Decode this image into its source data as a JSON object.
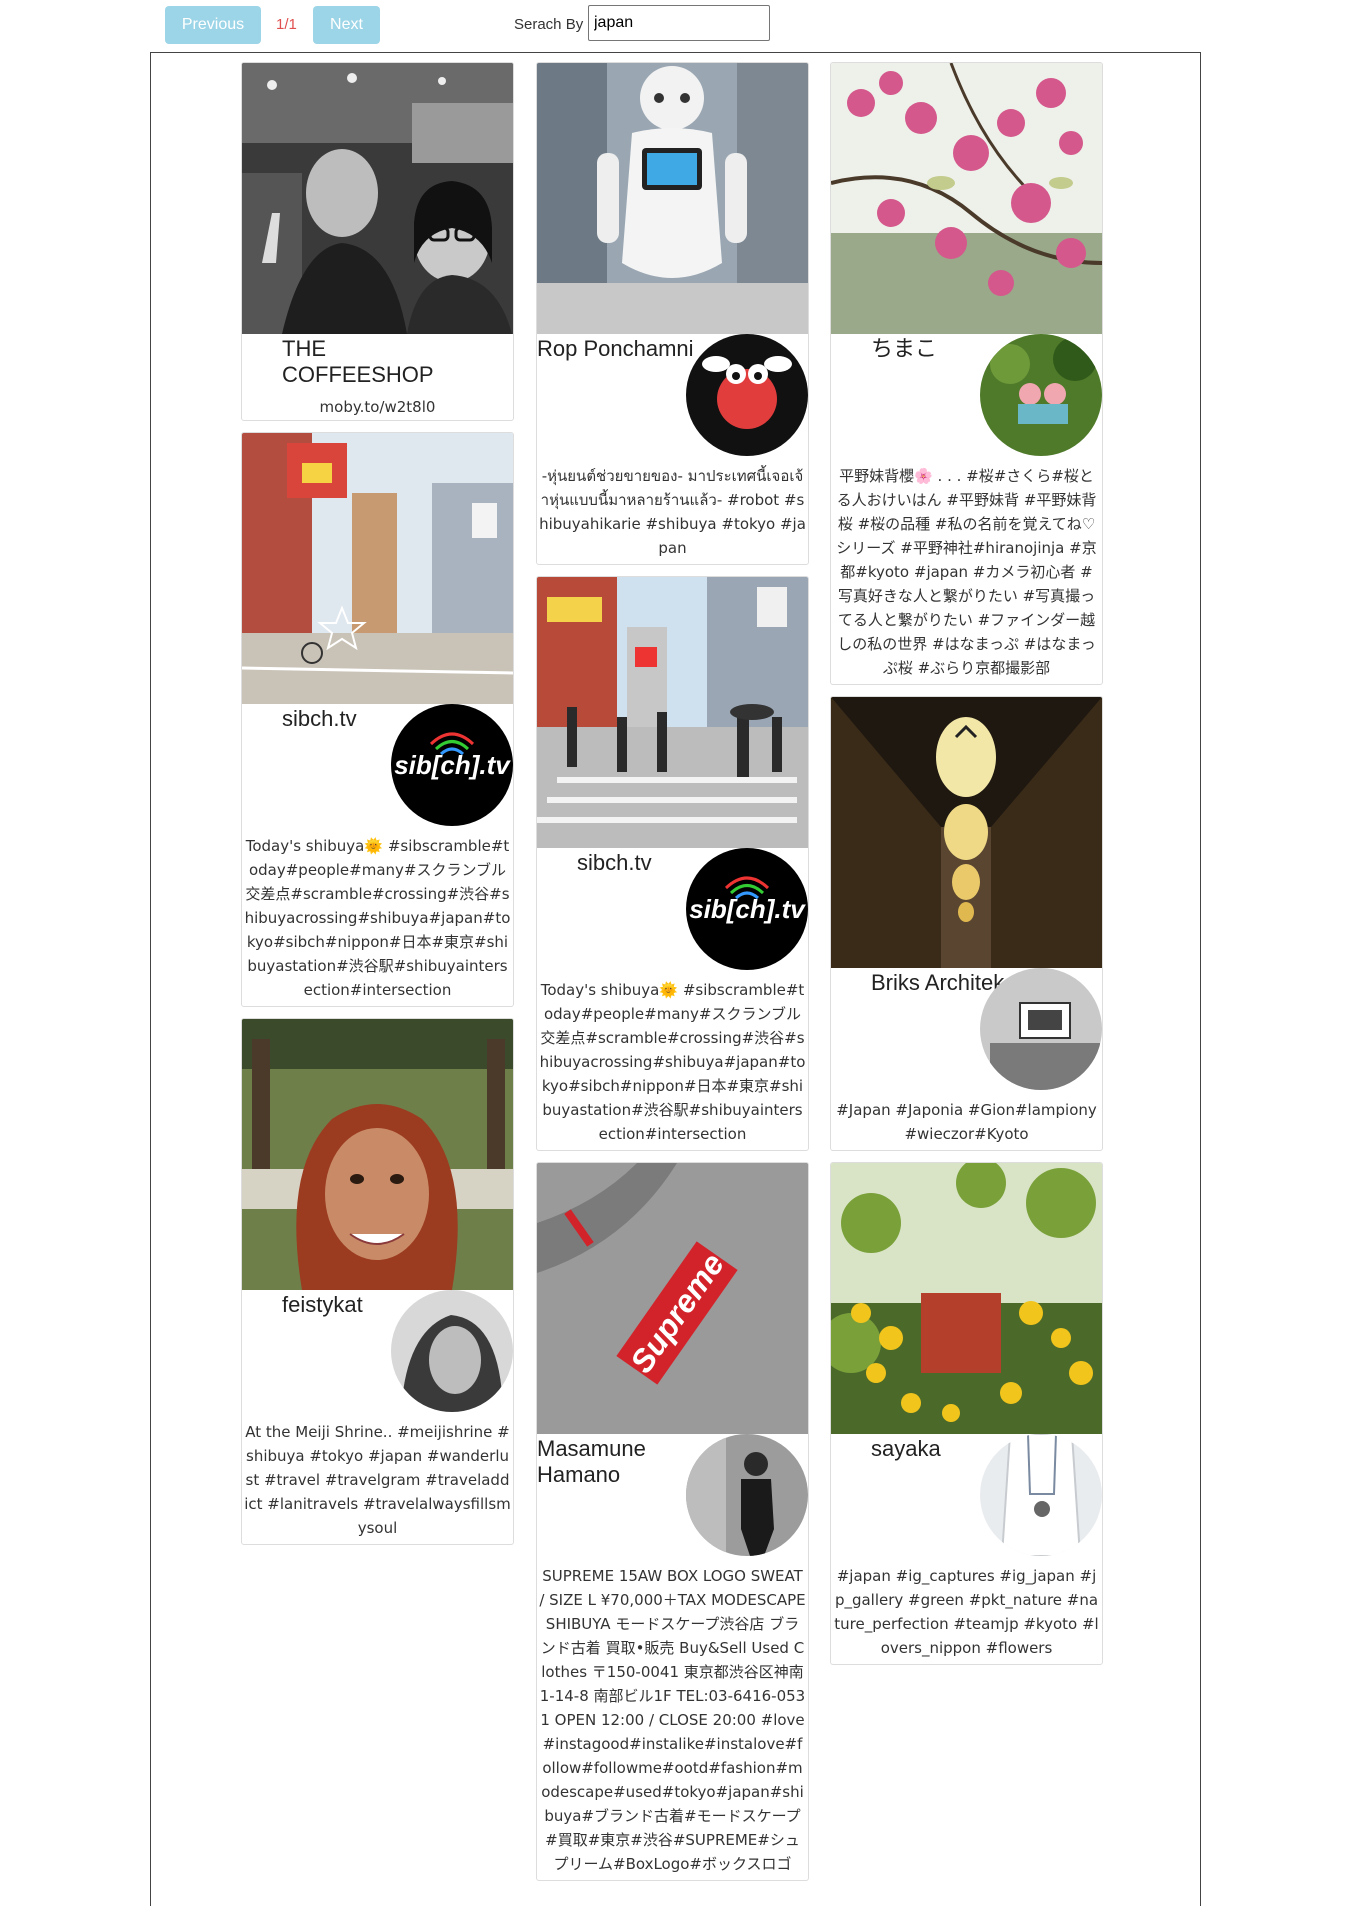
{
  "pager": {
    "previous_label": "Previous",
    "page_indicator": "1/1",
    "next_label": "Next"
  },
  "search": {
    "label": "Serach By",
    "value": "japan"
  },
  "colors": {
    "button": "#9cd5e7",
    "page_indicator": "#e05050"
  },
  "posts": [
    {
      "author": "THE COFFEESHOP",
      "link": "moby.to/w2t8l0",
      "photo_icon": "coffeeshop-photo-icon"
    },
    {
      "author": "Rop Ponchamni",
      "avatar_icon": "red-mascot-avatar-icon",
      "caption": "-หุ่นยนต์ช่วยขายของ- มาประเทศนี้เจอเจ้าหุ่นแบบนี้มาหลายร้านแล้ว- #robot #shibuyahikarie #shibuya #tokyo #japan",
      "photo_icon": "robot-photo-icon"
    },
    {
      "author": "ちまこ",
      "avatar_icon": "figures-garden-avatar-icon",
      "caption": "平野妹背櫻🌸 . . . #桜#さくら#桜とる人おけいはん #平野妹背 #平野妹背桜 #桜の品種 #私の名前を覚えてね♡シリーズ #平野神社#hiranojinja #京都#kyoto #japan #カメラ初心者 #写真好きな人と繋がりたい #写真撮ってる人と繋がりたい #ファインダー越しの私の世界 #はなまっぷ #はなまっぷ桜 #ぶらり京都撮影部",
      "photo_icon": "cherry-blossom-photo-icon"
    },
    {
      "author": "sibch.tv",
      "avatar_icon": "sibch-logo-avatar-icon",
      "caption": "Today's shibuya🌞 #sibscramble#today#people#many#スクランブル交差点#scramble#crossing#渋谷#shibuyacrossing#shibuya#japan#tokyo#sibch#nippon#日本#東京#shibuyastation#渋谷駅#shibuyaintersection#intersection",
      "photo_icon": "shibuya-street-photo-icon"
    },
    {
      "author": "sibch.tv",
      "avatar_icon": "sibch-logo-avatar-icon",
      "caption": "Today's shibuya🌞 #sibscramble#today#people#many#スクランブル交差点#scramble#crossing#渋谷#shibuyacrossing#shibuya#japan#tokyo#sibch#nippon#日本#東京#shibuyastation#渋谷駅#shibuyaintersection#intersection",
      "photo_icon": "shibuya-crossing-photo-icon"
    },
    {
      "author": "Briks Architekci",
      "avatar_icon": "gallery-wall-avatar-icon",
      "caption": "#Japan #Japonia #Gion#lampiony#wieczor#Kyoto",
      "photo_icon": "lantern-alley-photo-icon"
    },
    {
      "author": "feistykat",
      "avatar_icon": "portrait-avatar-icon",
      "caption": "At the Meiji Shrine.. #meijishrine #shibuya #tokyo #japan #wanderlust #travel #travelgram #traveladdict #lanitravels #travelalwaysfillsmysoul",
      "photo_icon": "selfie-shrine-photo-icon"
    },
    {
      "author": "Masamune Hamano",
      "avatar_icon": "street-person-avatar-icon",
      "caption": "SUPREME 15AW BOX LOGO SWEAT / SIZE L ¥70,000＋TAX MODESCAPE SHIBUYA モードスケープ渋谷店 ブランド古着 買取•販売 Buy&Sell Used Clothes 〒150-0041 東京都渋谷区神南1-14-8 南部ビル1F TEL:03-6416-0531 OPEN 12:00 / CLOSE 20:00 #love#instagood#instalike#instalove#follow#followme#ootd#fashion#modescape#used#tokyo#japan#shibuya#ブランド古着#モードスケープ#買取#東京#渋谷#SUPREME#シュプリーム#BoxLogo#ボックスロゴ",
      "photo_icon": "supreme-sweat-photo-icon",
      "photo_text": "Supreme"
    },
    {
      "author": "sayaka",
      "avatar_icon": "white-shirt-avatar-icon",
      "caption": "#japan #ig_captures #ig_japan #jp_gallery #green #pkt_nature #nature_perfection #teamjp #kyoto #lovers_nippon #flowers",
      "photo_icon": "yellow-flowers-photo-icon"
    }
  ]
}
